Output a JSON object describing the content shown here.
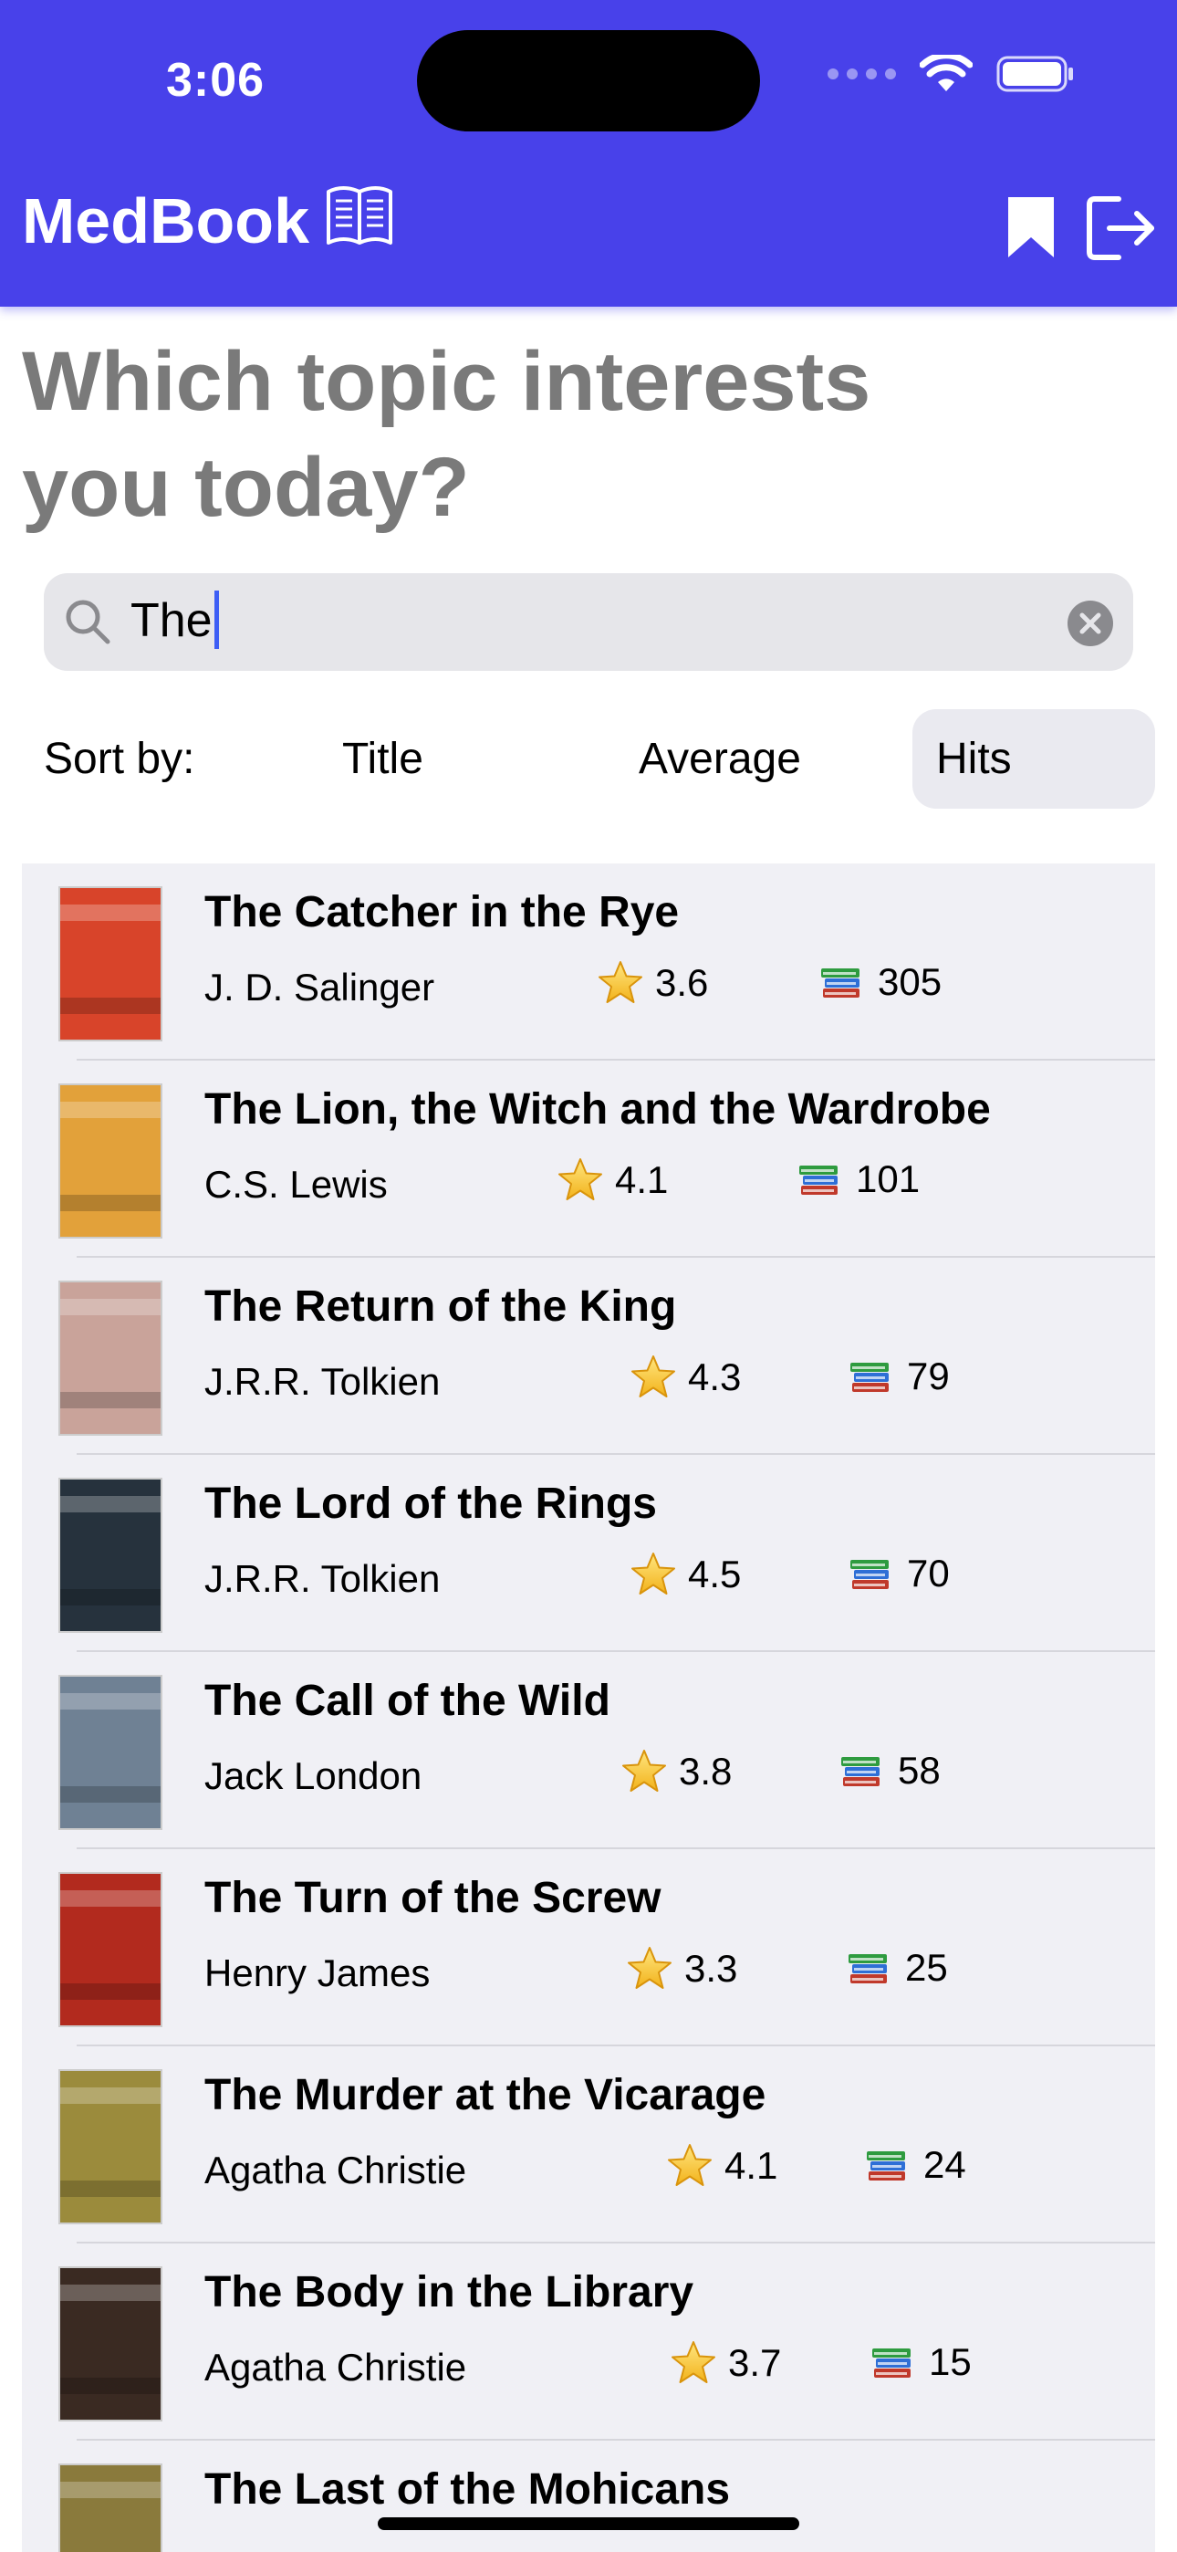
{
  "status_bar": {
    "time": "3:06"
  },
  "header": {
    "app_title": "MedBook",
    "icons": [
      "open-book-icon",
      "bookmark-icon",
      "logout-icon"
    ],
    "background": "#4841EA"
  },
  "heading": "Which topic interests you today?",
  "search": {
    "value": "The"
  },
  "sort": {
    "label": "Sort by:",
    "options": [
      "Title",
      "Average",
      "Hits"
    ],
    "selected": "Hits"
  },
  "books": [
    {
      "title": "The Catcher in the Rye",
      "author": "J. D. Salinger",
      "rating": "3.6",
      "hits": "305",
      "cover_color": "#d8442a"
    },
    {
      "title": "The Lion, the Witch and the Wardrobe",
      "author": "C.S. Lewis",
      "rating": "4.1",
      "hits": "101",
      "cover_color": "#e2a13a"
    },
    {
      "title": "The Return of the King",
      "author": "J.R.R. Tolkien",
      "rating": "4.3",
      "hits": "79",
      "cover_color": "#c9a39a"
    },
    {
      "title": "The Lord of the Rings",
      "author": "J.R.R. Tolkien",
      "rating": "4.5",
      "hits": "70",
      "cover_color": "#26323d"
    },
    {
      "title": "The Call of the Wild",
      "author": "Jack London",
      "rating": "3.8",
      "hits": "58",
      "cover_color": "#6f8194"
    },
    {
      "title": "The Turn of the Screw",
      "author": "Henry James",
      "rating": "3.3",
      "hits": "25",
      "cover_color": "#b22a1e"
    },
    {
      "title": "The Murder at the Vicarage",
      "author": "Agatha Christie",
      "rating": "4.1",
      "hits": "24",
      "cover_color": "#9b8b3c"
    },
    {
      "title": "The Body in the Library",
      "author": "Agatha Christie",
      "rating": "3.7",
      "hits": "15",
      "cover_color": "#3a2a22"
    },
    {
      "title": "The Last of the Mohicans",
      "author": "",
      "rating": "",
      "hits": "",
      "cover_color": "#8a7a3c"
    }
  ]
}
